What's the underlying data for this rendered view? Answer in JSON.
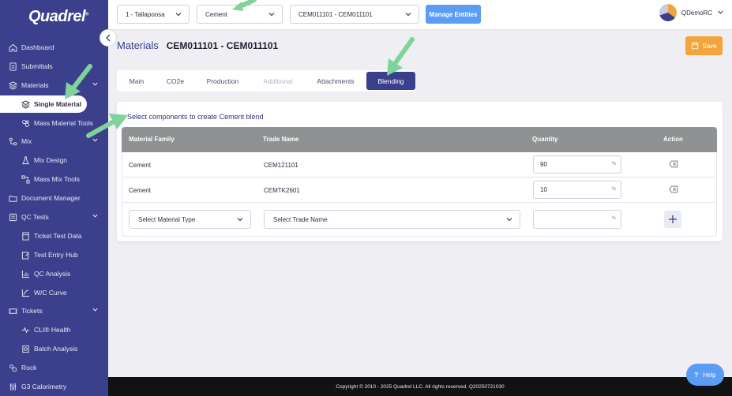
{
  "sidebar": {
    "logo": "Quadrel",
    "logo_mark": "®",
    "items": [
      {
        "label": "Dashboard",
        "icon": "home-icon"
      },
      {
        "label": "Submittals",
        "icon": "document-icon"
      },
      {
        "label": "Materials",
        "icon": "layers-icon"
      },
      {
        "label": "Single Material",
        "icon": "layers-icon"
      },
      {
        "label": "Mass Material Tools",
        "icon": "grid-icon"
      },
      {
        "label": "Mix",
        "icon": "mix-icon"
      },
      {
        "label": "Mix Design",
        "icon": "flask-icon"
      },
      {
        "label": "Mass Mix Tools",
        "icon": "nodes-icon"
      },
      {
        "label": "Document Manager",
        "icon": "folder-icon"
      },
      {
        "label": "QC Tests",
        "icon": "test-icon"
      },
      {
        "label": "Ticket Test Data",
        "icon": "ticket-icon"
      },
      {
        "label": "Test Entry Hub",
        "icon": "edit-icon"
      },
      {
        "label": "QC Analysis",
        "icon": "chart-icon"
      },
      {
        "label": "W/C Curve",
        "icon": "curve-icon"
      },
      {
        "label": "Tickets",
        "icon": "ticket-icon"
      },
      {
        "label": "CLI® Health",
        "icon": "health-icon"
      },
      {
        "label": "Batch Analysis",
        "icon": "batch-icon"
      },
      {
        "label": "Rock",
        "icon": "rock-icon"
      },
      {
        "label": "G3 Calorimetry",
        "icon": "calorimetry-icon"
      }
    ]
  },
  "topbar": {
    "plant": "1 - Tallapoosa",
    "material_type": "Cement",
    "material": "CEM011101 - CEM011101",
    "manage_label": "Manage Entities",
    "user": "QDemoRC"
  },
  "page": {
    "breadcrumb": "Materials",
    "code": "CEM011101 - CEM011101",
    "save_label": "Save"
  },
  "tabs": [
    "Main",
    "CO2e",
    "Production",
    "Additional",
    "Attachments",
    "Blending"
  ],
  "blending": {
    "heading": "Select components to create Cement blend",
    "columns": [
      "Material Family",
      "Trade Name",
      "Quantity",
      "Action"
    ],
    "rows": [
      {
        "family": "Cement",
        "trade": "CEM121101",
        "qty": "90",
        "unit": "%"
      },
      {
        "family": "Cement",
        "trade": "CEMTK2601",
        "qty": "10",
        "unit": "%"
      }
    ],
    "new_row": {
      "type_placeholder": "Select Material Type",
      "trade_placeholder": "Select Trade Name",
      "unit": "%"
    }
  },
  "footer": "Copyright © 2010 - 2025 Quadrel LLC. All rights reserved. Q20250721030",
  "help_label": "Help",
  "colors": {
    "sidebar": "#3b3f8c",
    "accent": "#f3a43b",
    "primary": "#5b9cf5",
    "arrow": "#7fd39a"
  }
}
